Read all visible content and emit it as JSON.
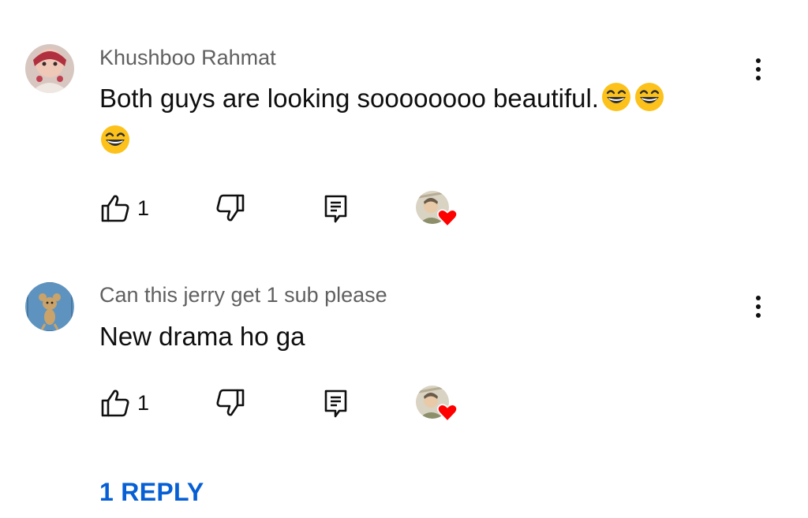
{
  "comments": [
    {
      "author": "Khushboo Rahmat",
      "text": "Both guys are looking soooooooo beautiful.",
      "likes": "1",
      "emoji": "smiling-face-with-open-mouth-icon"
    },
    {
      "author": "Can this jerry get 1 sub please",
      "text": "New drama ho ga",
      "likes": "1"
    }
  ],
  "replies": {
    "label": "1 REPLY"
  },
  "colors": {
    "link": "#065fd4",
    "heart": "#ff0000",
    "meta": "#606060"
  }
}
